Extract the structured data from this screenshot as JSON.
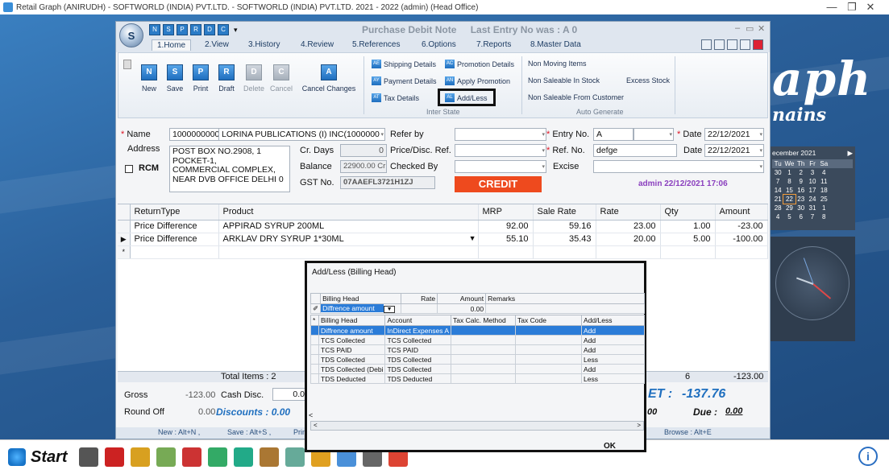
{
  "window": {
    "title": "Retail Graph (ANIRUDH) - SOFTWORLD (INDIA) PVT.LTD. - SOFTWORLD (INDIA) PVT.LTD. 2021 - 2022 (admin) (Head Office)",
    "controls": {
      "minimize": "—",
      "maximize": "❐",
      "close": "✕"
    }
  },
  "desktop": {
    "brand_large": "aph",
    "brand_small": "nains",
    "calendar": {
      "month_label": "ecember 2021",
      "next": "▶",
      "weekdays": [
        "Tu",
        "We",
        "Th",
        "Fr",
        "Sa"
      ],
      "weeks": [
        [
          "30",
          "1",
          "2",
          "3",
          "4"
        ],
        [
          "7",
          "8",
          "9",
          "10",
          "11"
        ],
        [
          "14",
          "15",
          "16",
          "17",
          "18"
        ],
        [
          "21",
          "22",
          "23",
          "24",
          "25"
        ],
        [
          "28",
          "29",
          "30",
          "31",
          "1"
        ],
        [
          "4",
          "5",
          "6",
          "7",
          "8"
        ]
      ],
      "today": "22"
    }
  },
  "app": {
    "header_title": "Purchase Debit Note",
    "last_entry": "Last Entry No was : A 0",
    "orb_label": "S",
    "qat_buttons": [
      "N",
      "S",
      "P",
      "R",
      "D",
      "C"
    ],
    "qat_dropdown": "▾",
    "win_min": "–",
    "win_max": "▭",
    "win_close": "✕",
    "tabs": [
      "1.Home",
      "2.View",
      "3.History",
      "4.Review",
      "5.References",
      "6.Options",
      "7.Reports",
      "8.Master Data"
    ],
    "ribbon": {
      "buttons": [
        {
          "label": "New",
          "icon": "N"
        },
        {
          "label": "Save",
          "icon": "S"
        },
        {
          "label": "Print",
          "icon": "P"
        },
        {
          "label": "Draft",
          "icon": "R"
        },
        {
          "label": "Delete",
          "icon": "D"
        },
        {
          "label": "Cancel",
          "icon": "C"
        },
        {
          "label": "Cancel Changes",
          "icon": "A"
        }
      ],
      "inter_state": {
        "shipping": "Shipping Details",
        "promotion": "Promotion Details",
        "payment": "Payment Details",
        "apply_promotion": "Apply Promotion",
        "tax": "Tax Details",
        "add_less": "Add/Less",
        "group_label": "Inter State"
      },
      "auto_generate": {
        "non_moving": "Non Moving Items",
        "non_saleable_stock": "Non Saleable In Stock",
        "excess_stock": "Excess Stock",
        "non_saleable_customer": "Non Saleable From Customer",
        "group_label": "Auto Generate"
      }
    },
    "form": {
      "name_label": "Name",
      "party_code": "1000000000",
      "party_name": "LORINA PUBLICATIONS (I) INC(1000000",
      "address_label": "Address",
      "address_lines": [
        "POST BOX NO.2908, 1",
        "POCKET-1,",
        "COMMERCIAL COMPLEX,",
        "NEAR DVB OFFICE  DELHI  0"
      ],
      "rcm_label": "RCM",
      "cr_days_label": "Cr. Days",
      "cr_days": "0",
      "balance_label": "Balance",
      "balance": "22900.00 Cr",
      "gst_label": "GST No.",
      "gst_no": "07AAEFL3721H1ZJ",
      "refer_by_label": "Refer by",
      "price_disc_label": "Price/Disc. Ref.",
      "checked_by_label": "Checked By",
      "credit_label": "CREDIT",
      "entry_no_label": "Entry No.",
      "entry_no": "A",
      "ref_no_label": "Ref. No.",
      "ref_no": "defge",
      "excise_label": "Excise",
      "date_label": "Date",
      "date1": "22/12/2021",
      "date2": "22/12/2021",
      "admin_info": "admin 22/12/2021 17:06"
    },
    "grid": {
      "columns": [
        "ReturnType",
        "Product",
        "MRP",
        "Sale Rate",
        "Rate",
        "Qty",
        "Amount"
      ],
      "rows": [
        {
          "return_type": "Price Difference",
          "product": "APPIRAD SYRUP 200ML",
          "mrp": "92.00",
          "sale_rate": "59.16",
          "rate": "23.00",
          "qty": "1.00",
          "amount": "-23.00"
        },
        {
          "return_type": "Price Difference",
          "product": "ARKLAV DRY SYRUP 1*30ML",
          "mrp": "55.10",
          "sale_rate": "35.43",
          "rate": "20.00",
          "qty": "5.00",
          "amount": "-100.00"
        }
      ],
      "current_marker": "▶",
      "new_marker": "*",
      "total_items": "Total Items : 2",
      "total_qty": "6",
      "total_amount": "-123.00"
    },
    "bottom": {
      "gross_label": "Gross",
      "gross": "-123.00",
      "cash_disc_label": "Cash Disc.",
      "cash_disc": "0.0",
      "round_off_label": "Round Off",
      "round_off": "0.00",
      "discounts_label": "Discounts :",
      "discounts": "0.00",
      "net_label": "ET :",
      "net": "-137.76",
      "partial_value": ".00",
      "due_label": "Due :",
      "due": "0.00"
    },
    "hints": {
      "new": "New : Alt+N ,",
      "save": "Save : Alt+S ,",
      "print": "Prin",
      "browse": "Browse : Alt+E"
    }
  },
  "dialog": {
    "title": "Add/Less (Billing Head)",
    "entry_columns": [
      "Billing Head",
      "Rate",
      "Amount",
      "Remarks"
    ],
    "entry_row": {
      "billing_head": "Diffrence amount",
      "amount": "0.00"
    },
    "list_columns": [
      "Billing Head",
      "Account",
      "Tax Calc. Method",
      "Tax Code",
      "Add/Less"
    ],
    "list_rows": [
      {
        "head": "Diffrence amount",
        "account": "InDirect Expenses A",
        "method": "",
        "code": "",
        "add_less": "Add"
      },
      {
        "head": "TCS Collected",
        "account": "TCS Collected",
        "method": "",
        "code": "",
        "add_less": "Add"
      },
      {
        "head": "TCS PAID",
        "account": "TCS PAID",
        "method": "",
        "code": "",
        "add_less": "Add"
      },
      {
        "head": "TDS Collected",
        "account": "TDS Collected",
        "method": "",
        "code": "",
        "add_less": "Less"
      },
      {
        "head": "TDS Collected (Debi",
        "account": "TDS Collected",
        "method": "",
        "code": "",
        "add_less": "Add"
      },
      {
        "head": "TDS Deducted",
        "account": "TDS Deducted",
        "method": "",
        "code": "",
        "add_less": "Less"
      }
    ],
    "scroll_left": "<",
    "scroll_right": ">",
    "ok_label": "OK",
    "edit_marker": "✐",
    "new_marker": "*"
  },
  "taskbar": {
    "start_label": "Start",
    "info_label": "i",
    "icons": [
      "calculator-icon",
      "book-icon",
      "paint-icon",
      "keyboard-icon",
      "pdf-icon",
      "re-icon",
      "pe-icon",
      "tools-icon",
      "network-icon",
      "paint-brush-icon",
      "ruler-icon",
      "printer-icon",
      "graph-icon"
    ]
  }
}
